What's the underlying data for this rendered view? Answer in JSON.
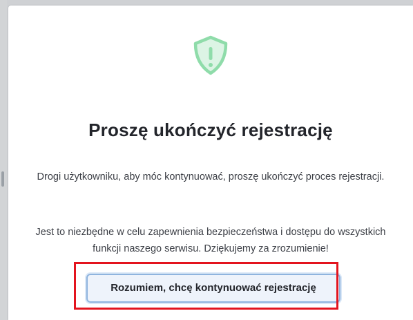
{
  "dialog": {
    "icon": "shield-alert-icon",
    "title": "Proszę ukończyć rejestrację",
    "message_line_1": "Drogi użytkowniku, aby móc kontynuować, proszę ukończyć proces rejestracji.",
    "message_line_2": "Jest to niezbędne w celu zapewnienia bezpieczeństwa i dostępu do wszystkich funkcji naszego serwisu. Dziękujemy za zrozumienie!",
    "confirm_button_label": "Rozumiem, chcę kontynuować rejestrację"
  },
  "colors": {
    "icon": "#8fdcaa",
    "highlight": "#e3141e",
    "button_border": "#8fb4de",
    "button_background": "#eef3fb"
  }
}
